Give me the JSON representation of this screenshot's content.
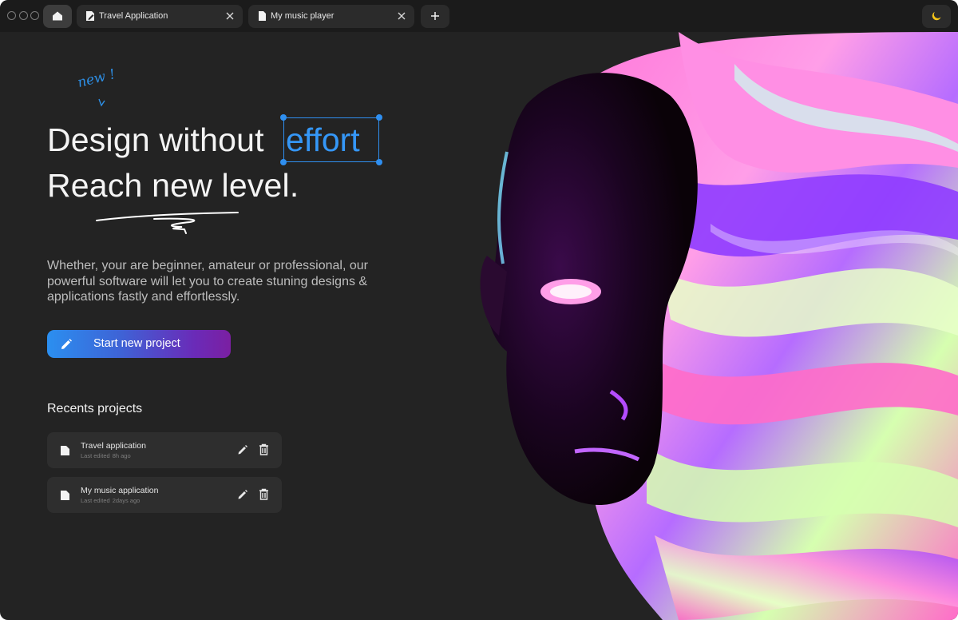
{
  "tabs": {
    "home_icon": "home-icon",
    "items": [
      {
        "label": "Travel Application",
        "icon": "document-edit-icon"
      },
      {
        "label": "My music player",
        "icon": "document-icon"
      }
    ],
    "new_tab_icon": "plus-icon",
    "theme_icon": "moon-icon"
  },
  "hero": {
    "note": "new !",
    "headline_line1": "Design without",
    "headline_highlight": "effort",
    "headline_line2": "Reach new level.",
    "subtitle": "Whether, your are beginner, amateur or professional, our powerful software will let you to create stuning designs & applications fastly and effortlessly.",
    "cta_label": "Start new project"
  },
  "recents": {
    "title": "Recents projects",
    "projects": [
      {
        "name": "Travel application",
        "meta_label": "Last edited",
        "meta_time": "8h ago"
      },
      {
        "name": "My music application",
        "meta_label": "Last edited",
        "meta_time": "2days ago"
      }
    ]
  },
  "colors": {
    "background": "#232323",
    "tabbar": "#1b1b1b",
    "accent": "#2f8ff0",
    "cta_gradient_start": "#2b8ff0",
    "cta_gradient_end": "#7b1fa2",
    "moon": "#f5c518"
  }
}
